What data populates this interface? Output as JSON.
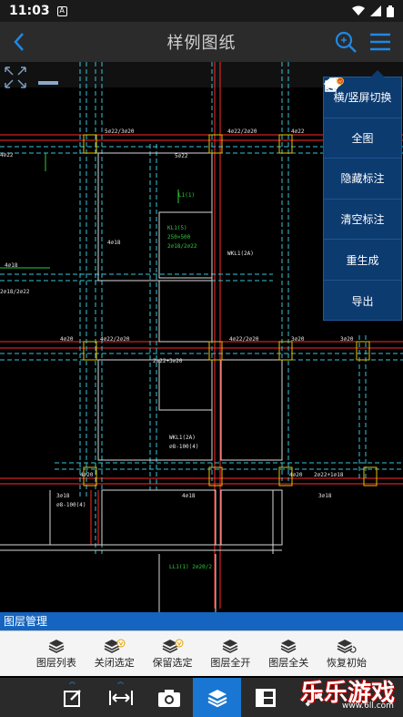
{
  "status_bar": {
    "time": "11:03",
    "notification": "A"
  },
  "title_bar": {
    "title": "样例图纸"
  },
  "dropdown_menu": {
    "items": [
      {
        "label": "横/竖屏切换",
        "icon": "rotate-screen-icon"
      },
      {
        "label": "全图",
        "icon": "full-view-icon"
      },
      {
        "label": "隐藏标注",
        "icon": "hide-eye-icon"
      },
      {
        "label": "清空标注",
        "icon": "clear-eye-icon"
      },
      {
        "label": "重生成",
        "icon": "regenerate-icon"
      },
      {
        "label": "导出",
        "icon": "export-send-icon"
      }
    ]
  },
  "layer_panel": {
    "header": "图层管理",
    "buttons": [
      {
        "label": "图层列表"
      },
      {
        "label": "关闭选定"
      },
      {
        "label": "保留选定"
      },
      {
        "label": "图层全开"
      },
      {
        "label": "图层全关"
      },
      {
        "label": "恢复初始"
      }
    ]
  },
  "watermark": {
    "text": "乐乐游戏",
    "url": "www.6ll.com"
  },
  "drawing_labels": {
    "a": "5⌀22/3⌀20",
    "b": "5⌀22",
    "c": "4⌀22/2⌀20",
    "d": "4⌀22",
    "e": "4⌀18",
    "f": "KL1(5)",
    "g": "250×500",
    "h": "2⌀18/2⌀22",
    "i": "L1(1)",
    "j": "4⌀22/2⌀20",
    "k": "3⌀18",
    "l": "WKL1(2A)",
    "m": "2⌀22+3⌀20",
    "n": "2⌀22+1⌀18",
    "o": "LL1(1) 2⌀20/2",
    "p": "⌀8-100(4)",
    "q": "4⌀20",
    "r": "2⌀22+3⌀20",
    "s": "3⌀20"
  },
  "colors": {
    "accent": "#1976d2",
    "menu_bg": "#0c3b70",
    "header_bg": "#2b2b2b",
    "cad_red": "#ff2a2a",
    "cad_green": "#2ecc40",
    "cad_cyan": "#36c5d9",
    "cad_white": "#e8e8e8"
  }
}
